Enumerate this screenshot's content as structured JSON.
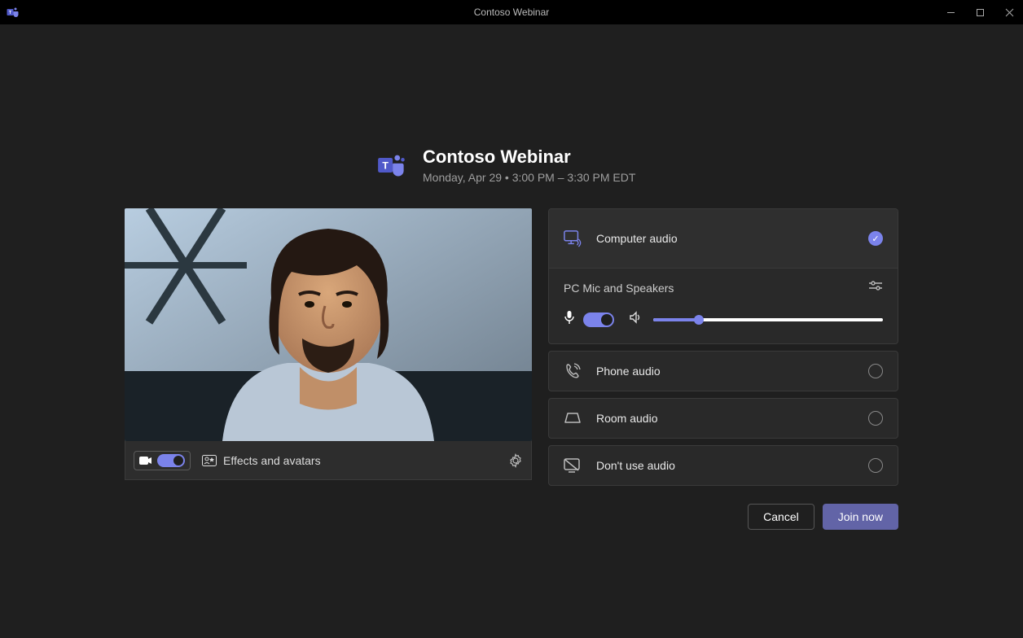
{
  "window": {
    "title": "Contoso Webinar"
  },
  "meeting": {
    "title": "Contoso Webinar",
    "time_line": "Monday, Apr 29  •  3:00 PM  –  3:30 PM  EDT"
  },
  "video": {
    "effects_label": "Effects and avatars",
    "camera_on": true
  },
  "audio": {
    "options": {
      "computer": "Computer audio",
      "phone": "Phone audio",
      "room": "Room audio",
      "none": "Don't use audio"
    },
    "device_label": "PC Mic and Speakers",
    "mic_on": true,
    "volume_pct": 20
  },
  "buttons": {
    "cancel": "Cancel",
    "join": "Join now"
  },
  "colors": {
    "accent": "#7b83eb",
    "button_primary": "#6264a7"
  }
}
